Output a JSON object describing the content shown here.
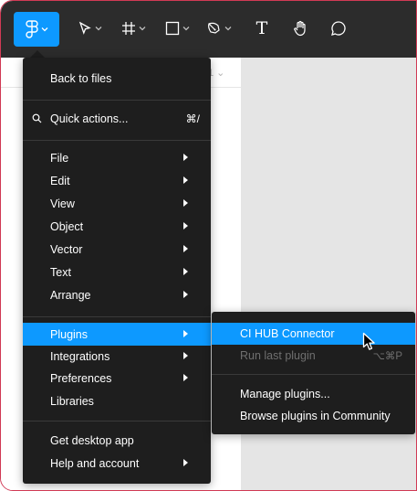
{
  "toolbar": {
    "tools": [
      {
        "name": "main-menu",
        "icon": "figma-logo-icon"
      },
      {
        "name": "move-tool",
        "icon": "cursor-arrow-icon"
      },
      {
        "name": "frame-tool",
        "icon": "frame-hash-icon"
      },
      {
        "name": "shape-tool",
        "icon": "rectangle-icon"
      },
      {
        "name": "pen-tool",
        "icon": "pen-icon"
      },
      {
        "name": "text-tool",
        "icon": "text-icon"
      },
      {
        "name": "hand-tool",
        "icon": "hand-icon"
      },
      {
        "name": "comment-tool",
        "icon": "comment-bubble-icon"
      }
    ],
    "text_tool_glyph": "T",
    "accent_color": "#0d99ff"
  },
  "panel": {
    "page_label": "1 ⌄"
  },
  "menu": {
    "back": "Back to files",
    "quick_actions": "Quick actions...",
    "quick_actions_shortcut": "⌘/",
    "items": [
      "File",
      "Edit",
      "View",
      "Object",
      "Vector",
      "Text",
      "Arrange"
    ],
    "plugins": "Plugins",
    "integrations": "Integrations",
    "preferences": "Preferences",
    "libraries": "Libraries",
    "get_desktop": "Get desktop app",
    "help": "Help and account"
  },
  "submenu": {
    "connector": "CI HUB Connector",
    "run_last": "Run last plugin",
    "run_last_shortcut": "⌥⌘P",
    "manage": "Manage plugins...",
    "browse": "Browse plugins in Community"
  }
}
